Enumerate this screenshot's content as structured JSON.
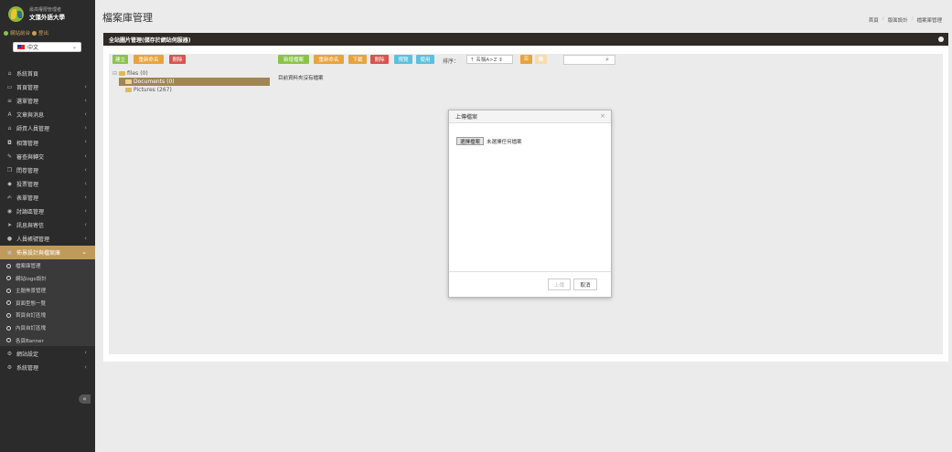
{
  "sidebar": {
    "brand_sub": "最高權限管理者",
    "brand_title": "文藻外語大學",
    "top_link": "網站前台",
    "logout": "登出",
    "language": "中文",
    "nav": [
      {
        "label": "系統首頁",
        "icon": "home-icon",
        "glyph": "⌂",
        "chevron": false
      },
      {
        "label": "首頁管理",
        "icon": "monitor-icon",
        "glyph": "▭",
        "chevron": true
      },
      {
        "label": "選單管理",
        "icon": "list-icon",
        "glyph": "≡",
        "chevron": true
      },
      {
        "label": "文章與消息",
        "icon": "font-icon",
        "glyph": "A",
        "chevron": true
      },
      {
        "label": "師資人員管理",
        "icon": "graduation-cap-icon",
        "glyph": "⌂",
        "chevron": true
      },
      {
        "label": "相簿管理",
        "icon": "camera-icon",
        "glyph": "◘",
        "chevron": true
      },
      {
        "label": "審查與轉交",
        "icon": "wrench-icon",
        "glyph": "✎",
        "chevron": true
      },
      {
        "label": "問卷管理",
        "icon": "copy-icon",
        "glyph": "❐",
        "chevron": true
      },
      {
        "label": "投票管理",
        "icon": "tag-icon",
        "glyph": "◆",
        "chevron": true
      },
      {
        "label": "表單管理",
        "icon": "edit-icon",
        "glyph": "✍",
        "chevron": true
      },
      {
        "label": "討論區管理",
        "icon": "comments-icon",
        "glyph": "◉",
        "chevron": true
      },
      {
        "label": "訊息與寄信",
        "icon": "send-icon",
        "glyph": "➤",
        "chevron": true
      },
      {
        "label": "人員帳號管理",
        "icon": "user-icon",
        "glyph": "●",
        "chevron": true
      },
      {
        "label": "佈景設計與檔案庫",
        "icon": "image-icon",
        "glyph": "▣",
        "chevron": true,
        "active": true
      }
    ],
    "sub_nav": [
      "檔案庫管理",
      "網站logo設計",
      "主題佈景管理",
      "頁面型態一覽",
      "首頁自訂區塊",
      "內頁自訂區塊",
      "各頁Banner"
    ],
    "nav_bottom": [
      {
        "label": "網站設定",
        "icon": "gear-icon",
        "glyph": "⚙"
      },
      {
        "label": "系統管理",
        "icon": "cog-icon",
        "glyph": "⚙"
      }
    ],
    "collapse_glyph": "«"
  },
  "header": {
    "title": "檔案庫管理",
    "breadcrumb": [
      "首頁",
      "版面設計",
      "檔案庫管理"
    ]
  },
  "panel": {
    "title": "全站圖片管理(儲存於網站伺服器)"
  },
  "tree_toolbar": {
    "create": "建立",
    "rename": "重新命名",
    "delete": "刪除"
  },
  "file_toolbar": {
    "new_file": "新增檔案",
    "rename": "重新命名",
    "download": "下載",
    "delete": "刪除",
    "preview": "預覽",
    "use": "使用",
    "sort_label": "排序：",
    "sort_value": "↑ 名稱A>Z ⇕"
  },
  "tree": {
    "root": "files (0)",
    "children": [
      "Documents (0)",
      "Pictures (267)"
    ]
  },
  "content": {
    "empty_message": "目前資料夾沒有檔案"
  },
  "dialog": {
    "title": "上傳檔案",
    "choose_file": "選擇檔案",
    "no_file": "未選擇任何檔案",
    "upload": "上傳",
    "cancel": "取消"
  },
  "colors": {
    "sidebar_bg": "#2b2b2b",
    "accent": "#c09a5a",
    "green": "#8bc34a",
    "orange": "#e8a33d",
    "red": "#d9534f",
    "blue": "#5bc0de"
  }
}
